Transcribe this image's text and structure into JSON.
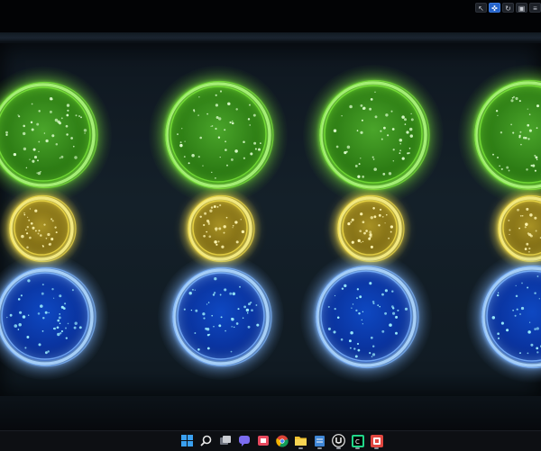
{
  "app": {
    "name": "Unreal Engine",
    "viewport": {
      "toolbar": {
        "buttons": [
          {
            "icon": "select-arrow-icon",
            "active": false
          },
          {
            "icon": "move-arrows-icon",
            "active": true
          },
          {
            "icon": "rotate-icon",
            "active": false
          },
          {
            "icon": "scale-icon",
            "active": false
          },
          {
            "icon": "menu-icon",
            "active": false
          }
        ]
      },
      "orbs": {
        "rows": [
          {
            "name": "green",
            "color": "#7ce63a",
            "fill": "#3a8a1c",
            "count": 4
          },
          {
            "name": "yellow",
            "color": "#f2dd4a",
            "fill": "#8a7418",
            "count": 4
          },
          {
            "name": "blue",
            "color": "#7fb6ff",
            "fill": "#0c3aa8",
            "count": 4
          }
        ]
      }
    }
  },
  "taskbar": {
    "icons": [
      {
        "name": "windows-start-icon"
      },
      {
        "name": "search-icon"
      },
      {
        "name": "task-view-icon"
      },
      {
        "name": "chat-icon"
      },
      {
        "name": "snip-icon"
      },
      {
        "name": "chrome-icon"
      },
      {
        "name": "file-explorer-icon"
      },
      {
        "name": "notepad-icon"
      },
      {
        "name": "unreal-engine-icon"
      },
      {
        "name": "clion-icon"
      },
      {
        "name": "red-app-icon"
      }
    ]
  }
}
